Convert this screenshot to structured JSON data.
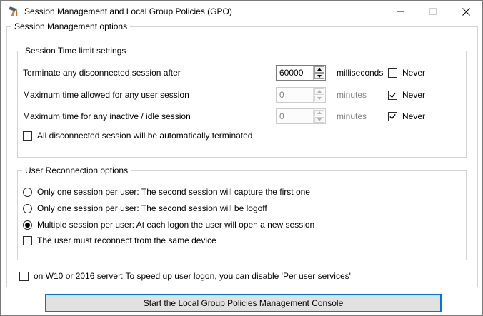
{
  "window": {
    "title": "Session Management and Local Group Policies (GPO)"
  },
  "outer_group": {
    "title": "Session Management options"
  },
  "time_limits": {
    "title": "Session Time limit settings",
    "rows": [
      {
        "label": "Terminate any disconnected session after",
        "value": "60000",
        "unit": "milliseconds",
        "never_label": "Never",
        "never_checked": false,
        "disabled": false
      },
      {
        "label": "Maximum time allowed for any user session",
        "value": "0",
        "unit": "minutes",
        "never_label": "Never",
        "never_checked": true,
        "disabled": true
      },
      {
        "label": "Maximum time for any inactive / idle session",
        "value": "0",
        "unit": "minutes",
        "never_label": "Never",
        "never_checked": true,
        "disabled": true
      }
    ],
    "auto_terminate_checkbox": {
      "label": "All disconnected session will be automatically terminated",
      "checked": false
    }
  },
  "reconnection": {
    "title": "User Reconnection options",
    "options": [
      {
        "label": "Only one session per user: The second session will capture the first one",
        "selected": false
      },
      {
        "label": "Only one session per user: The second session will be logoff",
        "selected": false
      },
      {
        "label": "Multiple session per user: At each logon the user will open a new session",
        "selected": true
      }
    ],
    "same_device_checkbox": {
      "label": "The user must reconnect from the same device",
      "checked": false
    }
  },
  "per_user_services_checkbox": {
    "label": "on W10 or 2016 server: To speed up user logon, you can disable 'Per user services'",
    "checked": false
  },
  "start_button": {
    "label": "Start the Local Group Policies Management Console"
  },
  "colors": {
    "accent": "#0078d7",
    "button_fill": "#e1e1e1",
    "disabled_text": "#838383",
    "group_border": "#d4d4d4",
    "window_border": "#7a7a7a"
  }
}
